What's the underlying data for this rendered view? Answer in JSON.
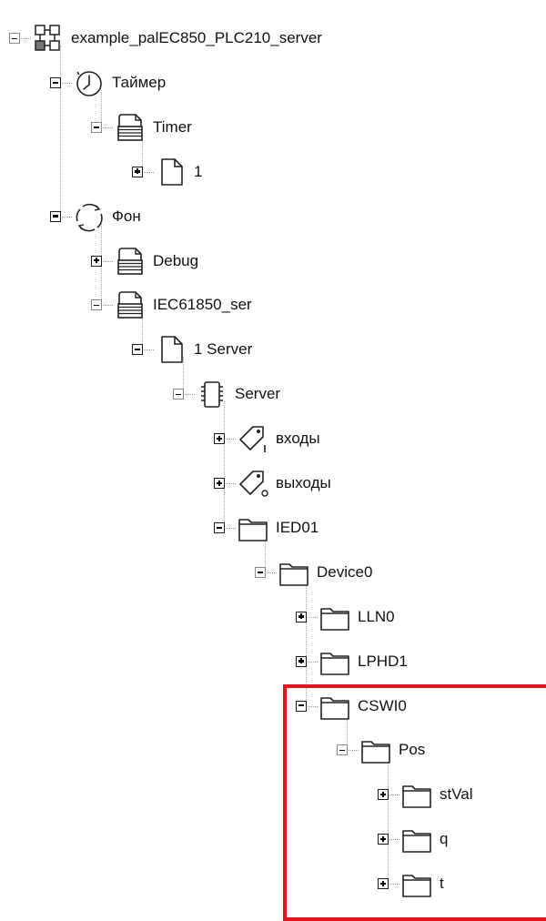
{
  "tree": [
    {
      "label": "example_palEC850_PLC210_server",
      "icon": "network-modules-icon",
      "level": 0,
      "toggle": "minus"
    },
    {
      "label": "Таймер",
      "icon": "clock-icon",
      "level": 1,
      "toggle": "minus"
    },
    {
      "label": "Timer",
      "icon": "program-stack-icon",
      "level": 2,
      "toggle": "minus"
    },
    {
      "label": "1",
      "icon": "document-icon",
      "level": 3,
      "toggle": "plus"
    },
    {
      "label": "Фон",
      "icon": "cycle-arrows-icon",
      "level": 1,
      "toggle": "minus"
    },
    {
      "label": "Debug",
      "icon": "program-stack-icon",
      "level": 2,
      "toggle": "plus"
    },
    {
      "label": "IEC61850_ser",
      "icon": "program-stack-icon",
      "level": 2,
      "toggle": "minus"
    },
    {
      "label": "1 Server",
      "icon": "document-icon",
      "level": 3,
      "toggle": "minus"
    },
    {
      "label": "Server",
      "icon": "chip-icon",
      "level": 4,
      "toggle": "minus"
    },
    {
      "label": "входы",
      "icon": "tag-input-icon",
      "level": 5,
      "toggle": "plus"
    },
    {
      "label": "выходы",
      "icon": "tag-output-icon",
      "level": 5,
      "toggle": "plus"
    },
    {
      "label": "IED01",
      "icon": "folder-icon",
      "level": 5,
      "toggle": "minus"
    },
    {
      "label": "Device0",
      "icon": "folder-icon",
      "level": 6,
      "toggle": "minus"
    },
    {
      "label": "LLN0",
      "icon": "folder-icon",
      "level": 7,
      "toggle": "plus"
    },
    {
      "label": "LPHD1",
      "icon": "folder-icon",
      "level": 7,
      "toggle": "plus"
    },
    {
      "label": "CSWI0",
      "icon": "folder-icon",
      "level": 7,
      "toggle": "minus"
    },
    {
      "label": "Pos",
      "icon": "folder-icon",
      "level": 8,
      "toggle": "minus"
    },
    {
      "label": "stVal",
      "icon": "folder-icon",
      "level": 9,
      "toggle": "plus"
    },
    {
      "label": "q",
      "icon": "folder-icon",
      "level": 9,
      "toggle": "plus"
    },
    {
      "label": "t",
      "icon": "folder-icon",
      "level": 9,
      "toggle": "plus"
    }
  ],
  "colors": {
    "highlight": "#e5141c",
    "text": "#111111",
    "connector": "#a8a8a8"
  }
}
